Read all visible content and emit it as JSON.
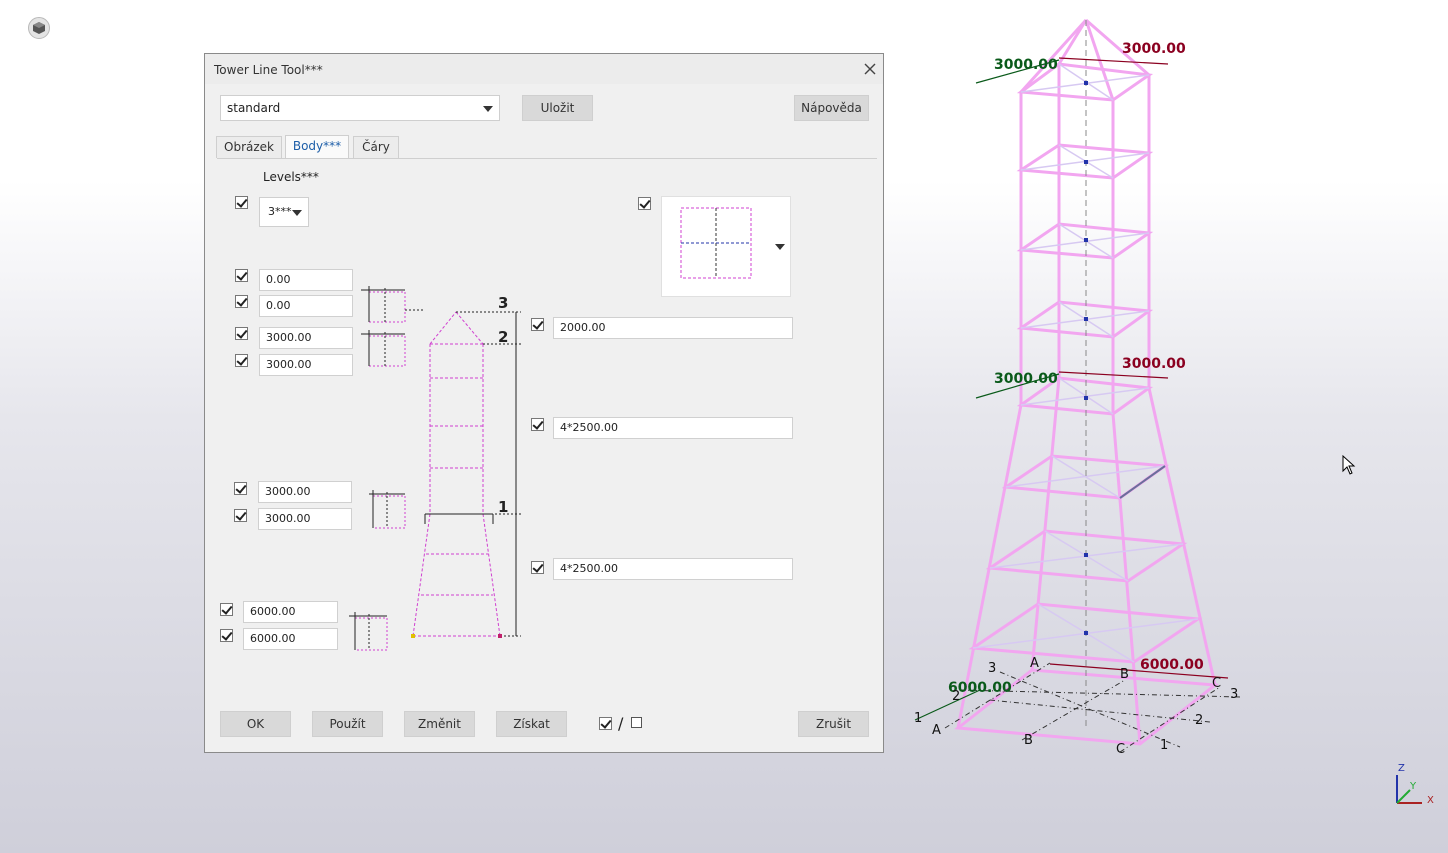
{
  "window_title": "Tower Line Tool***",
  "preset": {
    "value": "standard",
    "save_label": "Uložit",
    "help_label": "Nápověda"
  },
  "tabs": [
    "Obrázek",
    "Body***",
    "Čáry"
  ],
  "active_tab": "Body***",
  "levels": {
    "label": "Levels***",
    "value": "3***"
  },
  "left_fields": {
    "top_1": "0.00",
    "top_2": "0.00",
    "mid_1": "3000.00",
    "mid_2": "3000.00",
    "low_1": "3000.00",
    "low_2": "3000.00",
    "base_1": "6000.00",
    "base_2": "6000.00"
  },
  "right_fields": {
    "h3": "2000.00",
    "h2": "4*2500.00",
    "h1": "4*2500.00"
  },
  "level_marks": [
    "3",
    "2",
    "1"
  ],
  "footer": {
    "ok": "OK",
    "apply": "Použít",
    "change": "Změnit",
    "get": "Získat",
    "toggle_all": "/",
    "cancel": "Zrušit"
  },
  "viewport": {
    "top_dims": {
      "x": "3000.00",
      "y": "3000.00"
    },
    "mid_dims": {
      "x": "3000.00",
      "y": "3000.00"
    },
    "base_dims": {
      "x": "6000.00",
      "y": "6000.00"
    },
    "grid_letters": [
      "A",
      "B",
      "C"
    ],
    "grid_numbers": [
      "1",
      "2",
      "3"
    ],
    "axes": [
      "Z",
      "Y",
      "X"
    ]
  },
  "colors": {
    "tower": "#f2a6f0",
    "dim_red": "#8b0020",
    "dim_green": "#0a5a1a",
    "accent": "#1d5ea8"
  }
}
